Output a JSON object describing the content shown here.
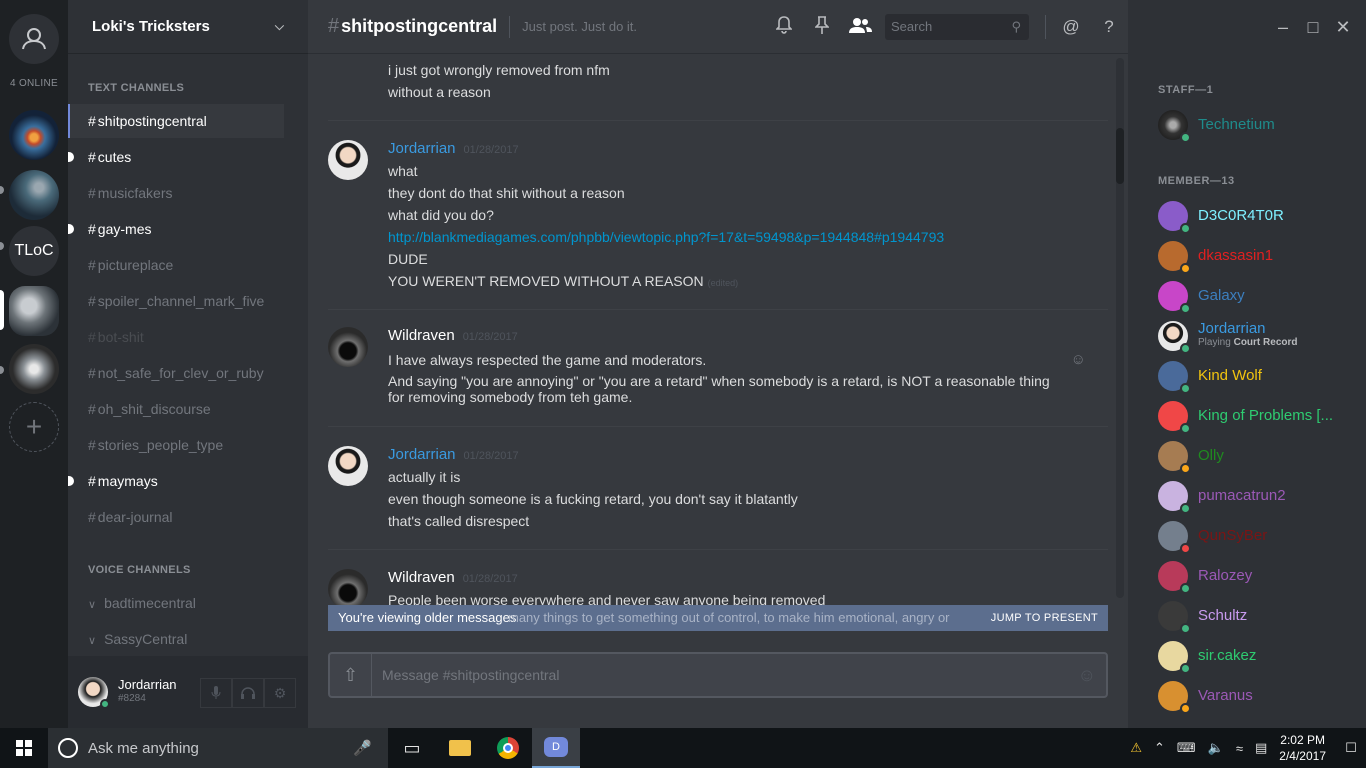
{
  "rail": {
    "online_count": "4 ONLINE",
    "servers": [
      {
        "name": "nebula-server"
      },
      {
        "name": "elf-server"
      },
      {
        "name": "tloc-server",
        "label": "TLoC"
      },
      {
        "name": "cats-server"
      },
      {
        "name": "skull-server"
      }
    ]
  },
  "sidebar": {
    "guild_name": "Loki's Tricksters",
    "text_category": "TEXT CHANNELS",
    "channels": [
      {
        "label": "shitpostingcentral",
        "state": "active"
      },
      {
        "label": "cutes",
        "state": "unread"
      },
      {
        "label": "musicfakers",
        "state": "read"
      },
      {
        "label": "gay-mes",
        "state": "unread"
      },
      {
        "label": "pictureplace",
        "state": "read"
      },
      {
        "label": "spoiler_channel_mark_five",
        "state": "read"
      },
      {
        "label": "bot-shit",
        "state": "muted"
      },
      {
        "label": "not_safe_for_clev_or_ruby",
        "state": "read"
      },
      {
        "label": "oh_shit_discourse",
        "state": "read"
      },
      {
        "label": "stories_people_type",
        "state": "read"
      },
      {
        "label": "maymays",
        "state": "unread"
      },
      {
        "label": "dear-journal",
        "state": "read"
      }
    ],
    "voice_category": "VOICE CHANNELS",
    "voice_channels": [
      {
        "label": "badtimecentral"
      },
      {
        "label": "SassyCentral"
      }
    ],
    "user": {
      "name": "Jordarrian",
      "discriminator": "#8284"
    }
  },
  "header": {
    "hash": "#",
    "channel": "shitpostingcentral",
    "topic": "Just post. Just do it.",
    "search_placeholder": "Search"
  },
  "messages": [
    {
      "author": "",
      "lines": [
        "i just got wrongly removed from nfm",
        "without a reason"
      ]
    },
    {
      "author": "Jordarrian",
      "color": "#3a9ae0",
      "timestamp": "01/28/2017",
      "lines": [
        "what",
        "they dont do that shit without a reason",
        "what did you do?"
      ],
      "link": "http://blankmediagames.com/phpbb/viewtopic.php?f=17&t=59498&p=1944848#p1944793",
      "lines2": [
        "DUDE"
      ],
      "edited_line": "YOU WEREN'T REMOVED WITHOUT A REASON",
      "edited_tag": "(edited)"
    },
    {
      "author": "Wildraven",
      "color": "#ffffff",
      "timestamp": "01/28/2017",
      "lines": [
        "I have always respected the game and moderators.",
        "And saying \"you are annoying\" or \"you are a retard\" when somebody is a retard, is NOT a reasonable thing for removing somebody from teh game."
      ]
    },
    {
      "author": "Jordarrian",
      "color": "#3a9ae0",
      "timestamp": "01/28/2017",
      "lines": [
        "actually it is",
        "even though someone is a fucking retard, you don't say it blatantly",
        "that's called disrespect"
      ]
    },
    {
      "author": "Wildraven",
      "color": "#ffffff",
      "timestamp": "01/28/2017",
      "lines": [
        "People been worse everywhere and never saw anyone being removed",
        "many things to get something out of control, to make him emotional, angry or"
      ]
    }
  ],
  "banner": {
    "text": "You're viewing older messages",
    "jump": "JUMP TO PRESENT"
  },
  "composer": {
    "placeholder": "Message #shitpostingcentral"
  },
  "members": {
    "staff_header": "STAFF—1",
    "staff": [
      {
        "name": "Technetium",
        "color": "#1f8b8b",
        "status": "online"
      }
    ],
    "member_header": "MEMBER—13",
    "list": [
      {
        "name": "D3C0R4T0R",
        "color": "#7ef0ff",
        "status": "online",
        "avatar": "#8a5cc9"
      },
      {
        "name": "dkassasin1",
        "color": "#e02020",
        "status": "idle",
        "avatar": "#b86a2e"
      },
      {
        "name": "Galaxy",
        "color": "#3c7fbf",
        "status": "online",
        "avatar": "#c846c8"
      },
      {
        "name": "Jordarrian",
        "color": "#3a9ae0",
        "status": "online",
        "avatar": "#d8c2b0",
        "playing_prefix": "Playing",
        "playing": "Court Record"
      },
      {
        "name": "Kind Wolf",
        "color": "#f1c40f",
        "status": "online",
        "avatar": "#4a6a9a"
      },
      {
        "name": "King of Problems [...",
        "color": "#2ecc71",
        "status": "online",
        "avatar": "#f04747"
      },
      {
        "name": "Olly",
        "color": "#1f8b1f",
        "status": "idle",
        "avatar": "#a67c52"
      },
      {
        "name": "pumacatrun2",
        "color": "#9b59b6",
        "status": "online",
        "avatar": "#c9b3e0"
      },
      {
        "name": "QunSyBer",
        "color": "#7a1515",
        "status": "dnd",
        "avatar": "#747f8d"
      },
      {
        "name": "Ralozey",
        "color": "#9b59b6",
        "status": "online",
        "avatar": "#b83a5a"
      },
      {
        "name": "Schultz",
        "color": "#c99bf0",
        "status": "online",
        "avatar": "#3a3a3a"
      },
      {
        "name": "sir.cakez",
        "color": "#2ecc71",
        "status": "online",
        "avatar": "#e8d8a0"
      },
      {
        "name": "Varanus",
        "color": "#9b59b6",
        "status": "idle",
        "avatar": "#d89030"
      }
    ]
  },
  "taskbar": {
    "search_text": "Ask me anything",
    "time": "2:02 PM",
    "date": "2/4/2017",
    "discord_label": "D"
  }
}
